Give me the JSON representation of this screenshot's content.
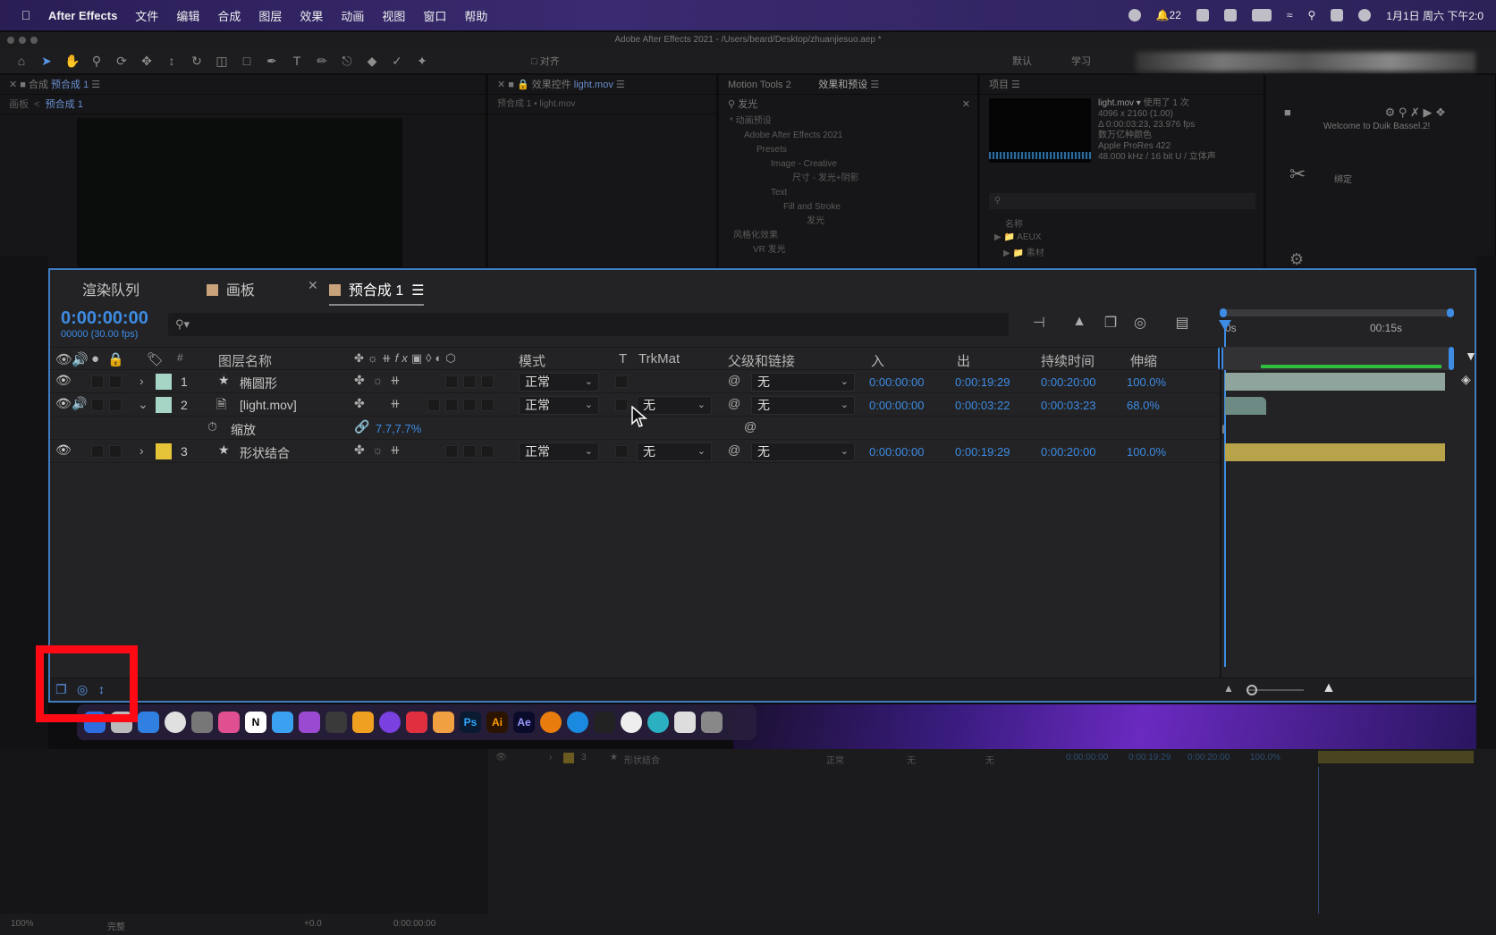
{
  "menubar": {
    "app": "After Effects",
    "items": [
      "文件",
      "编辑",
      "合成",
      "图层",
      "效果",
      "动画",
      "视图",
      "窗口",
      "帮助"
    ],
    "notif_count": "22",
    "clock": "1月1日 周六 下午2:0"
  },
  "window_title": "Adobe After Effects 2021 - /Users/beard/Desktop/zhuanjiesuo.aep *",
  "toolbar": {
    "snap": "对齐",
    "ws_default": "默认",
    "ws_learn": "学习"
  },
  "panels": {
    "comp": {
      "title": "合成",
      "name": "预合成 1",
      "tab2": "画板",
      "crumb": "预合成 1"
    },
    "effects_controls": {
      "title": "效果控件",
      "file": "light.mov",
      "sub": "预合成 1 • light.mov"
    },
    "motion_tools": "Motion Tools 2",
    "effects_presets": {
      "title": "效果和预设",
      "search": "发光",
      "tree": [
        "* 动画预设",
        "Adobe After Effects 2021",
        "Presets",
        "Image - Creative",
        "尺寸 - 发光+阴影",
        "Text",
        "Fill and Stroke",
        "发光",
        "风格化效果",
        "VR 发光"
      ]
    },
    "project": {
      "title": "项目",
      "file": "light.mov ▾",
      "used": "使用了 1 次",
      "meta": [
        "4096 x 2160 (1.00)",
        "Δ 0:00:03:23, 23.976 fps",
        "数万亿种颜色",
        "Apple ProRes 422",
        "48.000 kHz / 16 bit U / 立体声"
      ],
      "col_name": "名称",
      "folders": [
        "AEUX",
        "素材"
      ]
    },
    "duik": {
      "welcome": "Welcome to Duik Bassel.2!",
      "bind": "绑定"
    }
  },
  "timeline": {
    "tabs": {
      "render": "渲染队列",
      "board": "画板",
      "comp": "预合成 1"
    },
    "timecode": "0:00:00:00",
    "frames": "00000 (30.00 fps)",
    "search_icon": "search-icon",
    "headers": {
      "num": "#",
      "name": "图层名称",
      "mode": "模式",
      "t": "T",
      "trkmat": "TrkMat",
      "parent": "父级和链接",
      "in": "入",
      "out": "出",
      "duration": "持续时间",
      "stretch": "伸缩"
    },
    "ruler": {
      "start": "0s",
      "mark": "00:15s"
    },
    "layers": [
      {
        "num": "1",
        "name": "椭圆形",
        "mode": "正常",
        "trkmat": "",
        "parent": "无",
        "in": "0:00:00:00",
        "out": "0:00:19:29",
        "dur": "0:00:20:00",
        "stretch": "100.0%",
        "color": "#a6d5c6"
      },
      {
        "num": "2",
        "name": "[light.mov]",
        "mode": "正常",
        "trkmat": "无",
        "parent": "无",
        "in": "0:00:00:00",
        "out": "0:00:03:22",
        "dur": "0:00:03:23",
        "stretch": "68.0%",
        "color": "#a6d5c6"
      },
      {
        "num": "3",
        "name": "形状结合",
        "mode": "正常",
        "trkmat": "无",
        "parent": "无",
        "in": "0:00:00:00",
        "out": "0:00:19:29",
        "dur": "0:00:20:00",
        "stretch": "100.0%",
        "color": "#e6c43a"
      }
    ],
    "scale": {
      "label": "缩放",
      "value": "7.7,7.7%"
    }
  },
  "dock_labels": {
    "ps": "Ps",
    "ai": "Ai",
    "ae": "Ae",
    "notion": "N"
  },
  "ghost_row": {
    "num": "3",
    "name": "形状结合",
    "mode": "正常",
    "trk": "无",
    "parent": "无",
    "in": "0:00:00:00",
    "out": "0:00:19:29",
    "dur": "0:00:20:00",
    "stretch": "100.0%"
  },
  "status": {
    "zoom": "100%",
    "quality": "完整",
    "exposure": "+0.0",
    "tc": "0:00:00:00"
  }
}
